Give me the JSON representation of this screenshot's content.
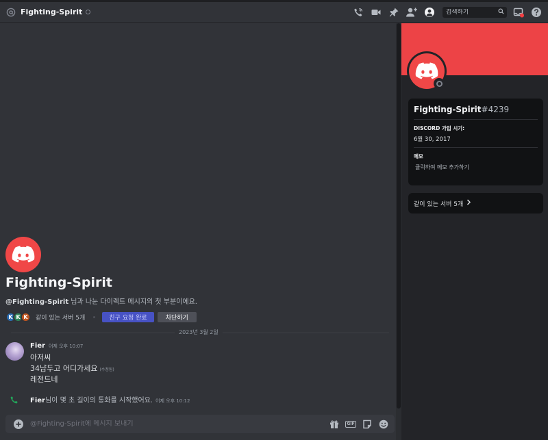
{
  "header": {
    "title": "Fighting-Spirit",
    "search_placeholder": "검색하기"
  },
  "welcome": {
    "name": "Fighting-Spirit",
    "handle": "@Fighting-Spirit",
    "subtitle": " 님과 나눈 다이렉트 메시지의 첫 부분이에요.",
    "mutual_servers": "같이 있는 서버 5개",
    "mutual_avatar_letters": [
      "K",
      "K",
      "K"
    ],
    "friend_button": "친구 요청 완료",
    "block_button": "차단하기"
  },
  "divider": {
    "date": "2023년 3월 2일"
  },
  "message": {
    "author": "Fier",
    "time": "어제 오후 10:07",
    "lines": [
      "아저씨",
      "34냡두고 어디가세요",
      "레전드네"
    ],
    "edited": "(수정됨)"
  },
  "call": {
    "author": "Fier",
    "text": "님이 몇 초 길이의 통화를 시작했어요.",
    "time": "어제 오후 10:12"
  },
  "composer": {
    "placeholder": "@Fighting-Spirit에 메시지 보내기"
  },
  "profile": {
    "username": "Fighting-Spirit",
    "discriminator": "#4239",
    "member_since_label": "DISCORD 가입 시기:",
    "member_since": "6월 30, 2017",
    "note_label": "메모",
    "note_placeholder": "클릭하여 메모 추가하기",
    "mutual_servers": "같이 있는 서버 5개"
  },
  "colors": {
    "banner": "#ed4346",
    "avatar": "#f04747",
    "blurple_button": "#4752c4",
    "call_green": "#23a55a"
  },
  "icons": {
    "header": [
      "at-icon",
      "voice-call-icon",
      "video-call-icon",
      "pin-icon",
      "add-friend-icon",
      "profile-toggle-icon",
      "search-icon",
      "inbox-icon",
      "help-icon"
    ],
    "composer": [
      "plus-icon",
      "gift-icon",
      "gif-icon",
      "sticker-icon",
      "emoji-icon"
    ]
  }
}
